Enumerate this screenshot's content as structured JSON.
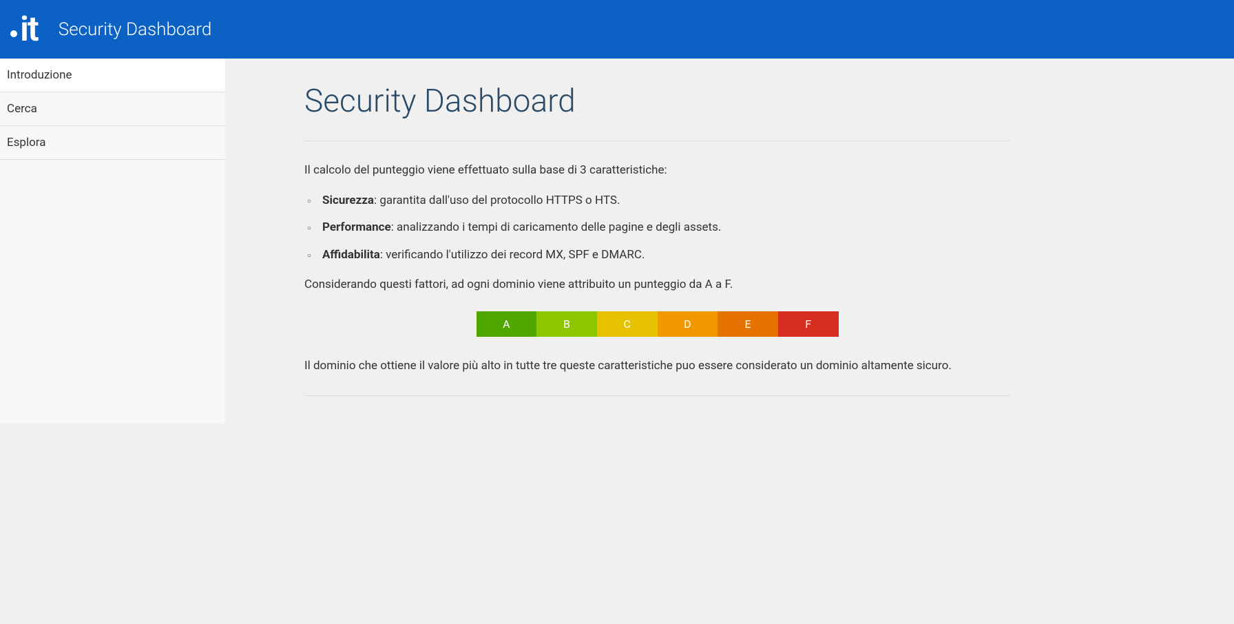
{
  "header": {
    "logo_text": "it",
    "title": "Security Dashboard"
  },
  "sidebar": {
    "items": [
      {
        "label": "Introduzione",
        "active": true
      },
      {
        "label": "Cerca",
        "active": false
      },
      {
        "label": "Esplora",
        "active": false
      }
    ]
  },
  "main": {
    "title": "Security Dashboard",
    "intro": "Il calcolo del punteggio viene effettuato sulla base di 3 caratteristiche:",
    "features": [
      {
        "term": "Sicurezza",
        "desc": ": garantita dall'uso del protocollo HTTPS o HTS."
      },
      {
        "term": "Performance",
        "desc": ": analizzando i tempi di caricamento delle pagine e degli assets."
      },
      {
        "term": "Affidabilita",
        "desc": ": verificando l'utilizzo dei record MX, SPF e DMARC."
      }
    ],
    "summary": "Considerando questi fattori, ad ogni dominio viene attribuito un punteggio da A a F.",
    "ratings": [
      {
        "label": "A",
        "color": "#52a600"
      },
      {
        "label": "B",
        "color": "#8cc600"
      },
      {
        "label": "C",
        "color": "#e6c200"
      },
      {
        "label": "D",
        "color": "#f29900"
      },
      {
        "label": "E",
        "color": "#e67300"
      },
      {
        "label": "F",
        "color": "#d62e1f"
      }
    ],
    "closing": "Il dominio che ottiene il valore più alto in tutte tre queste caratteristiche puo essere considerato un dominio altamente sicuro."
  }
}
